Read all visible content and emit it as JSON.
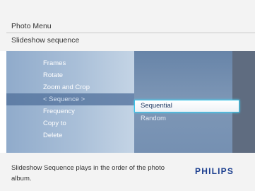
{
  "header": {
    "title": "Photo Menu",
    "subtitle": "Slideshow sequence"
  },
  "menu": {
    "items": [
      {
        "label": "Frames"
      },
      {
        "label": "Rotate"
      },
      {
        "label": "Zoom and Crop"
      },
      {
        "label": "< Sequence >",
        "active": true
      },
      {
        "label": "Frequency"
      },
      {
        "label": "Copy to"
      },
      {
        "label": "Delete"
      }
    ]
  },
  "submenu": {
    "items": [
      {
        "label": "Sequential",
        "selected": true
      },
      {
        "label": "Random"
      }
    ]
  },
  "footer": {
    "help_text": "Slideshow Sequence plays in the order of the photo album.",
    "brand": "PHILIPS"
  },
  "colors": {
    "selection_border": "#3cc3e8",
    "brand": "#1c3f8f"
  }
}
